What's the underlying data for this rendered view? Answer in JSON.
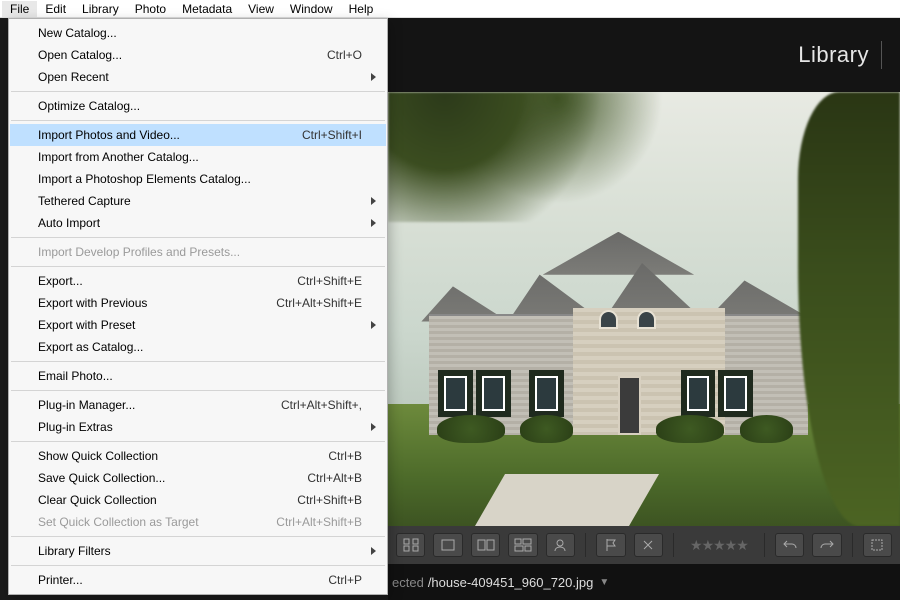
{
  "menubar": [
    "File",
    "Edit",
    "Library",
    "Photo",
    "Metadata",
    "View",
    "Window",
    "Help"
  ],
  "menubar_open_index": 0,
  "module_label": "Library",
  "file_menu": {
    "groups": [
      [
        {
          "label": "New Catalog...",
          "shortcut": "",
          "sub": false,
          "disabled": false
        },
        {
          "label": "Open Catalog...",
          "shortcut": "Ctrl+O",
          "sub": false,
          "disabled": false
        },
        {
          "label": "Open Recent",
          "shortcut": "",
          "sub": true,
          "disabled": false
        }
      ],
      [
        {
          "label": "Optimize Catalog...",
          "shortcut": "",
          "sub": false,
          "disabled": false
        }
      ],
      [
        {
          "label": "Import Photos and Video...",
          "shortcut": "Ctrl+Shift+I",
          "sub": false,
          "disabled": false,
          "highlight": true
        },
        {
          "label": "Import from Another Catalog...",
          "shortcut": "",
          "sub": false,
          "disabled": false
        },
        {
          "label": "Import a Photoshop Elements Catalog...",
          "shortcut": "",
          "sub": false,
          "disabled": false
        },
        {
          "label": "Tethered Capture",
          "shortcut": "",
          "sub": true,
          "disabled": false
        },
        {
          "label": "Auto Import",
          "shortcut": "",
          "sub": true,
          "disabled": false
        }
      ],
      [
        {
          "label": "Import Develop Profiles and Presets...",
          "shortcut": "",
          "sub": false,
          "disabled": true
        }
      ],
      [
        {
          "label": "Export...",
          "shortcut": "Ctrl+Shift+E",
          "sub": false,
          "disabled": false
        },
        {
          "label": "Export with Previous",
          "shortcut": "Ctrl+Alt+Shift+E",
          "sub": false,
          "disabled": false
        },
        {
          "label": "Export with Preset",
          "shortcut": "",
          "sub": true,
          "disabled": false
        },
        {
          "label": "Export as Catalog...",
          "shortcut": "",
          "sub": false,
          "disabled": false
        }
      ],
      [
        {
          "label": "Email Photo...",
          "shortcut": "",
          "sub": false,
          "disabled": false
        }
      ],
      [
        {
          "label": "Plug-in Manager...",
          "shortcut": "Ctrl+Alt+Shift+,",
          "sub": false,
          "disabled": false
        },
        {
          "label": "Plug-in Extras",
          "shortcut": "",
          "sub": true,
          "disabled": false
        }
      ],
      [
        {
          "label": "Show Quick Collection",
          "shortcut": "Ctrl+B",
          "sub": false,
          "disabled": false
        },
        {
          "label": "Save Quick Collection...",
          "shortcut": "Ctrl+Alt+B",
          "sub": false,
          "disabled": false
        },
        {
          "label": "Clear Quick Collection",
          "shortcut": "Ctrl+Shift+B",
          "sub": false,
          "disabled": false
        },
        {
          "label": "Set Quick Collection as Target",
          "shortcut": "Ctrl+Alt+Shift+B",
          "sub": false,
          "disabled": true
        }
      ],
      [
        {
          "label": "Library Filters",
          "shortcut": "",
          "sub": true,
          "disabled": false
        }
      ],
      [
        {
          "label": "Printer...",
          "shortcut": "Ctrl+P",
          "sub": false,
          "disabled": false
        }
      ]
    ]
  },
  "toolbar": {
    "icons": [
      "grid-icon",
      "loupe-icon",
      "compare-icon",
      "survey-icon",
      "face-icon",
      "flag-icon",
      "reject-icon",
      "rotate-ccw-icon",
      "rotate-cw-icon",
      "crop-icon"
    ]
  },
  "status": {
    "label": "ected",
    "path": "/house-409451_960_720.jpg"
  }
}
